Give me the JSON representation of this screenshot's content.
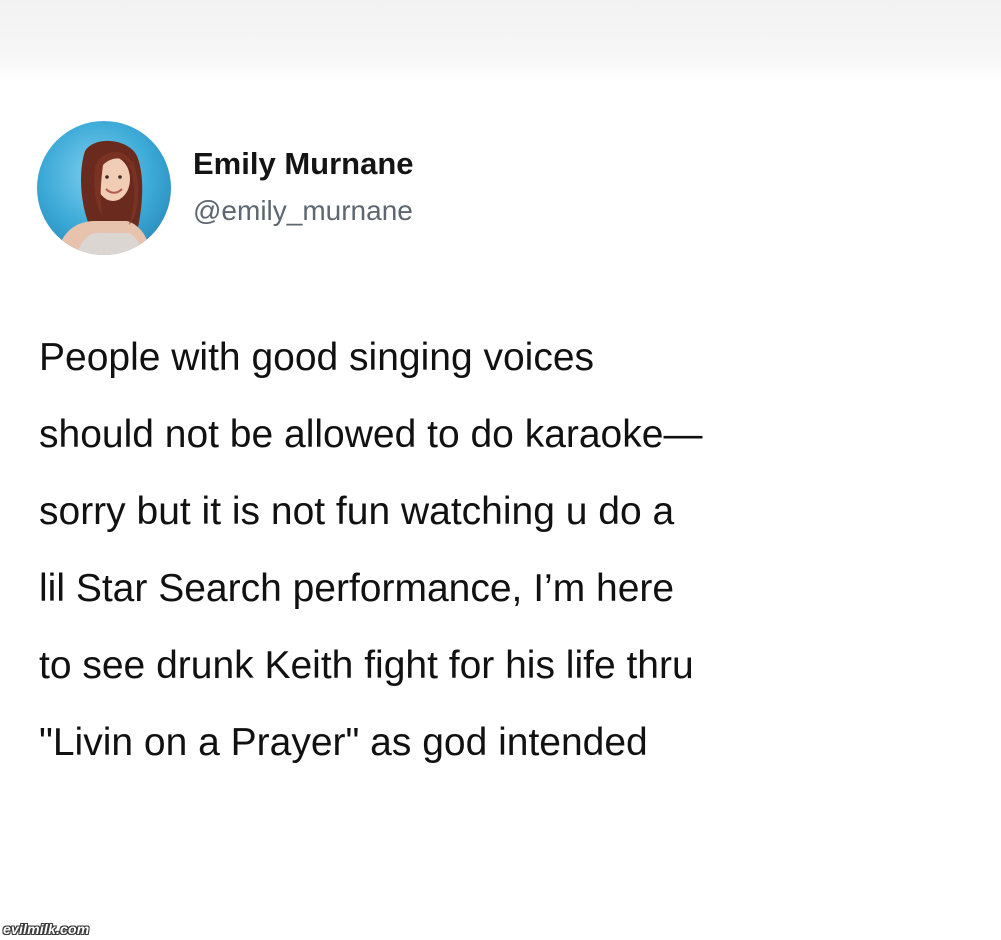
{
  "author": {
    "display_name": "Emily Murnane",
    "handle": "@emily_murnane",
    "avatar_icon": "profile-photo"
  },
  "tweet": {
    "lines": [
      "People with good singing voices",
      "should not be allowed to do karaoke—",
      "sorry but it is not fun watching u do a",
      "lil Star Search performance, I’m here",
      "to see drunk Keith fight for his life thru",
      "\"Livin on a Prayer\" as god intended"
    ]
  },
  "watermark": {
    "text": "evilmilk.com"
  },
  "colors": {
    "background": "#ffffff",
    "text": "#111111",
    "handle": "#5e6670",
    "avatar_bg": "#3aa8d6"
  }
}
